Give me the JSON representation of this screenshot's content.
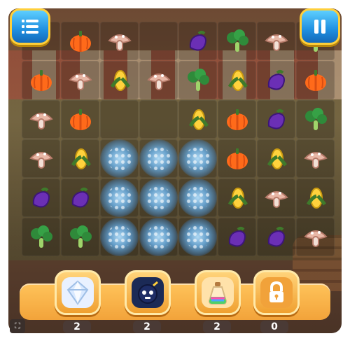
{
  "game": {
    "board": {
      "rows": 6,
      "cols": 8,
      "tiles": [
        [
          "blank",
          "pumpkin",
          "mushroom",
          "blank",
          "eggplant",
          "broccoli",
          "mushroom",
          "broccoli"
        ],
        [
          "pumpkin",
          "mushroom",
          "corn",
          "mushroom",
          "broccoli",
          "corn",
          "eggplant",
          "pumpkin"
        ],
        [
          "mushroom",
          "pumpkin",
          "blank",
          "blank",
          "corn",
          "pumpkin",
          "eggplant",
          "broccoli"
        ],
        [
          "mushroom",
          "corn",
          "sparkle",
          "sparkle",
          "sparkle",
          "pumpkin",
          "corn",
          "mushroom"
        ],
        [
          "eggplant",
          "eggplant",
          "sparkle",
          "sparkle",
          "sparkle",
          "corn",
          "mushroom",
          "corn"
        ],
        [
          "broccoli",
          "broccoli",
          "sparkle",
          "sparkle",
          "sparkle",
          "eggplant",
          "eggplant",
          "mushroom"
        ]
      ]
    },
    "buttons": {
      "menu": {
        "icon": "menu-icon"
      },
      "pause": {
        "icon": "pause-icon"
      }
    },
    "boosters": [
      {
        "name": "diamond",
        "icon": "diamond-icon",
        "count": "2"
      },
      {
        "name": "bomb",
        "icon": "bomb-icon",
        "count": "2"
      },
      {
        "name": "potion",
        "icon": "potion-icon",
        "count": "2"
      },
      {
        "name": "lock",
        "icon": "lock-icon",
        "count": "0"
      }
    ],
    "colors": {
      "accent_blue": "#1f8fe0",
      "gold": "#ffcf3a",
      "booster_bar": "#f2a33a"
    }
  }
}
